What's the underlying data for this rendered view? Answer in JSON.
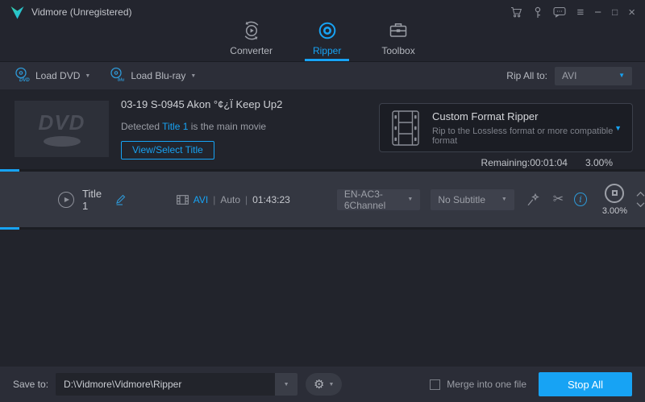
{
  "titlebar": {
    "app_title": "Vidmore (Unregistered)"
  },
  "glyphs": {
    "menu": "≡",
    "minimize": "−",
    "maximize": "□",
    "close": "×",
    "scissors": "✂",
    "gear": "⚙",
    "dropdown": "▼",
    "separator": "|",
    "info": "i",
    "play": "▶"
  },
  "tabs": [
    {
      "label": "Converter"
    },
    {
      "label": "Ripper"
    },
    {
      "label": "Toolbox"
    }
  ],
  "toolbar": {
    "load_dvd": "Load DVD",
    "load_bluray": "Load Blu-ray",
    "rip_all_label": "Rip All to:",
    "rip_all_value": "AVI"
  },
  "source": {
    "disc_text": "DVD",
    "title": "03-19 S-0945 Akon °¢¿Ï Keep Up2",
    "detected_prefix": "Detected ",
    "detected_title": "Title 1",
    "detected_suffix": " is the main movie",
    "view_button": "View/Select Title"
  },
  "format_panel": {
    "title": "Custom Format Ripper",
    "subtitle": "Rip to the Lossless format or more compatible format"
  },
  "progress": {
    "remaining": "Remaining:00:01:04",
    "percent": "3.00%"
  },
  "title_row": {
    "name": "Title 1",
    "format": "AVI",
    "mode": "Auto",
    "duration": "01:43:23",
    "audio_track": "EN-AC3-6Channel",
    "subtitle_track": "No Subtitle",
    "percent": "3.00%"
  },
  "bottombar": {
    "save_label": "Save to:",
    "save_path": "D:\\Vidmore\\Vidmore\\Ripper",
    "merge_label": "Merge into one file",
    "stop_button": "Stop All"
  },
  "colors": {
    "accent": "#17a3f4",
    "background": "#22242c",
    "panel": "#1b1d24",
    "row": "#343741",
    "bar": "#2b2d37"
  }
}
